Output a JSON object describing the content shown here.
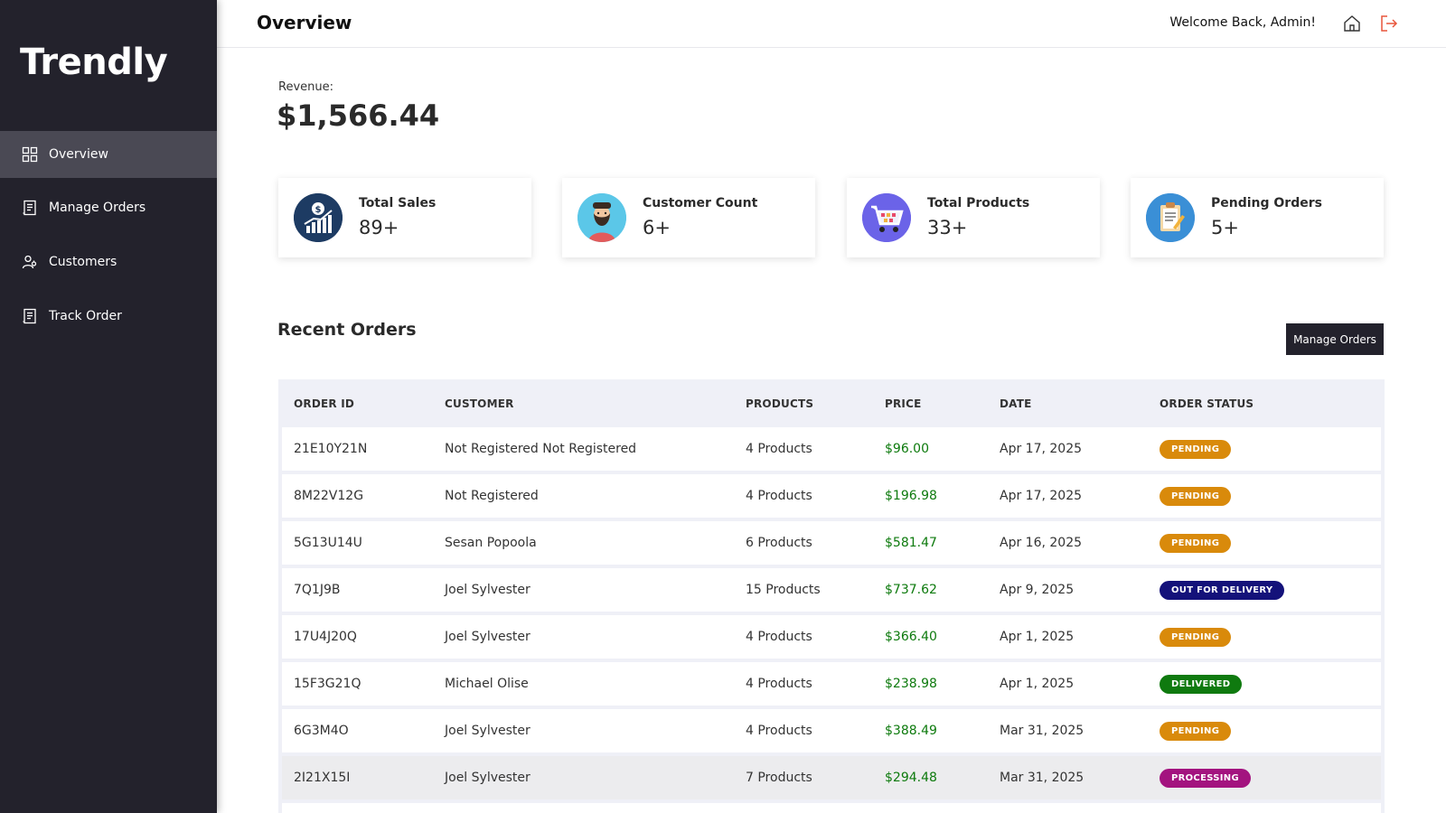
{
  "brand": "Trendly",
  "sidebar": {
    "items": [
      {
        "label": "Overview",
        "icon": "grid-icon"
      },
      {
        "label": "Manage Orders",
        "icon": "receipt-icon"
      },
      {
        "label": "Customers",
        "icon": "users-icon"
      },
      {
        "label": "Track Order",
        "icon": "receipt-icon"
      }
    ]
  },
  "header": {
    "title": "Overview",
    "welcome": "Welcome Back, Admin!",
    "icons": [
      "home-icon",
      "logout-icon"
    ]
  },
  "revenue": {
    "label": "Revenue:",
    "value": "$1,566.44"
  },
  "stats": [
    {
      "title": "Total Sales",
      "value": "89+",
      "icon": "sales-chart-icon"
    },
    {
      "title": "Customer Count",
      "value": "6+",
      "icon": "customer-avatar-icon"
    },
    {
      "title": "Total Products",
      "value": "33+",
      "icon": "shopping-cart-icon"
    },
    {
      "title": "Pending Orders",
      "value": "5+",
      "icon": "clipboard-icon"
    }
  ],
  "recent_orders": {
    "title": "Recent Orders",
    "manage_label": "Manage Orders",
    "columns": [
      "ORDER ID",
      "CUSTOMER",
      "PRODUCTS",
      "PRICE",
      "DATE",
      "ORDER STATUS"
    ],
    "rows": [
      {
        "id": "21E10Y21N",
        "customer": "Not Registered Not Registered",
        "products": "4 Products",
        "price": "$96.00",
        "date": "Apr 17, 2025",
        "status": "PENDING"
      },
      {
        "id": "8M22V12G",
        "customer": "Not Registered",
        "products": "4 Products",
        "price": "$196.98",
        "date": "Apr 17, 2025",
        "status": "PENDING"
      },
      {
        "id": "5G13U14U",
        "customer": "Sesan Popoola",
        "products": "6 Products",
        "price": "$581.47",
        "date": "Apr 16, 2025",
        "status": "PENDING"
      },
      {
        "id": "7Q1J9B",
        "customer": "Joel Sylvester",
        "products": "15 Products",
        "price": "$737.62",
        "date": "Apr 9, 2025",
        "status": "OUT FOR DELIVERY"
      },
      {
        "id": "17U4J20Q",
        "customer": "Joel Sylvester",
        "products": "4 Products",
        "price": "$366.40",
        "date": "Apr 1, 2025",
        "status": "PENDING"
      },
      {
        "id": "15F3G21Q",
        "customer": "Michael Olise",
        "products": "4 Products",
        "price": "$238.98",
        "date": "Apr 1, 2025",
        "status": "DELIVERED"
      },
      {
        "id": "6G3M4O",
        "customer": "Joel Sylvester",
        "products": "4 Products",
        "price": "$388.49",
        "date": "Mar 31, 2025",
        "status": "PENDING"
      },
      {
        "id": "2I21X15I",
        "customer": "Joel Sylvester",
        "products": "7 Products",
        "price": "$294.48",
        "date": "Mar 31, 2025",
        "status": "PROCESSING"
      }
    ]
  },
  "status_colors": {
    "PENDING": "#d98a0b",
    "OUT FOR DELIVERY": "#14127a",
    "DELIVERED": "#0f7a0f",
    "PROCESSING": "#a3137f"
  },
  "colors": {
    "sidebar_bg": "#23222c",
    "active_item": "#4a4954",
    "price_green": "#0d7a0d",
    "logout_red": "#e8553b"
  }
}
